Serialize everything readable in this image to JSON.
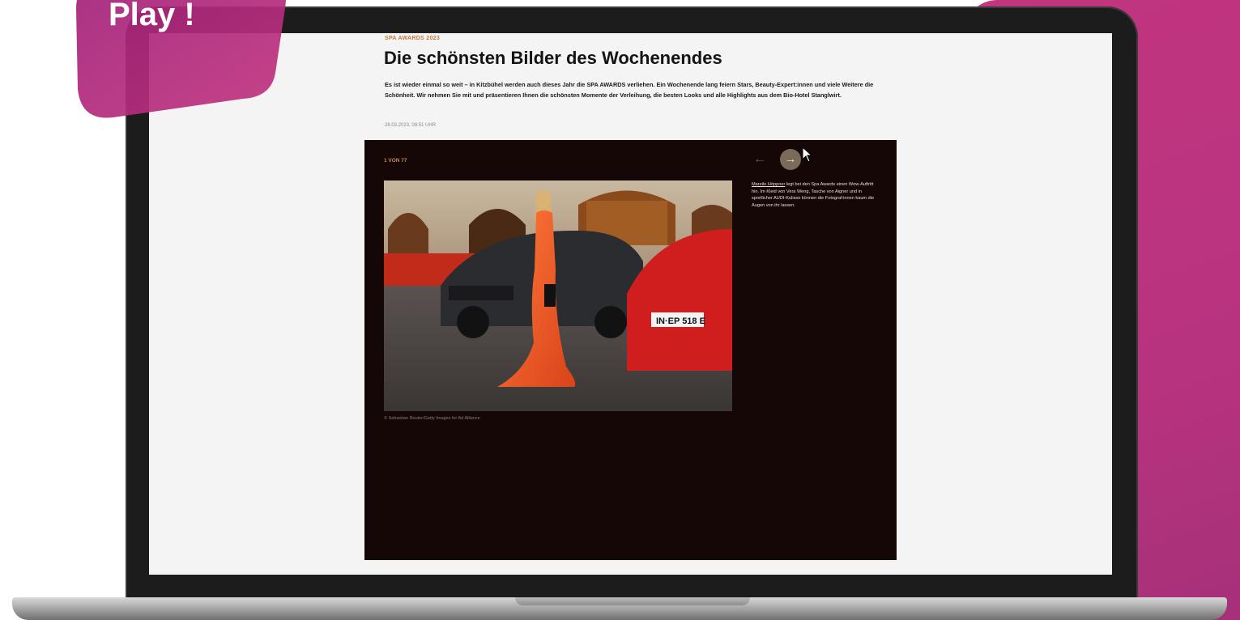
{
  "badge": {
    "label": "Play !"
  },
  "article": {
    "kicker": "SPA AWARDS 2023",
    "headline": "Die schönsten Bilder des Wochenendes",
    "intro": "Es ist wieder einmal so weit – in Kitzbühel werden auch dieses Jahr die SPA AWARDS verliehen. Ein Wochenende lang feiern Stars, Beauty-Expert:innen und viele Weitere die Schönheit. Wir nehmen Sie mit und präsentieren Ihnen die schönsten Momente der Verleihung, die besten Looks und alle Highlights aus dem Bio-Hotel Stanglwirt.",
    "dateline": "28.03.2023, 08:51 UHR"
  },
  "gallery": {
    "counter": "1 VON 77",
    "prev_icon": "arrow-left-icon",
    "next_icon": "arrow-right-icon",
    "prev_glyph": "←",
    "next_glyph": "→",
    "caption_name": "Mareile Höppner",
    "caption_text": " legt bei den Spa Awards einen Wow-Auftritt hin. Im Kleid von Vera Weng, Tasche von Aigner und in sportlicher AUDI-Kulisse können die Fotograf:innen kaum die Augen von ihr lassen.",
    "credit": "© Sebastian Reuter/Getty Images for Ad Alliance",
    "license_plate": "IN·EP 518 E"
  },
  "colors": {
    "accent_magenta": "#b8337f",
    "gallery_bg": "#160707",
    "kicker": "#c47a3a"
  }
}
